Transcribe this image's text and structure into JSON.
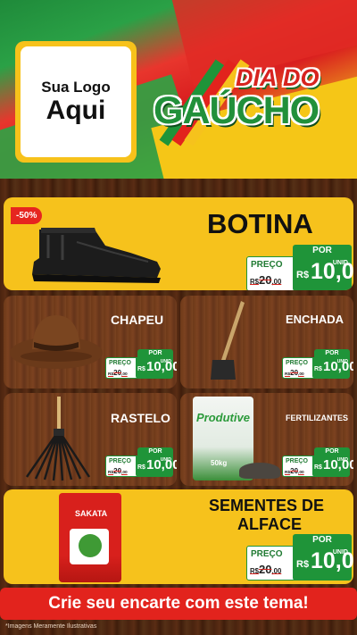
{
  "header": {
    "logo_line1": "Sua Logo",
    "logo_line2": "Aqui",
    "title_top": "DIA DO",
    "title_bottom": "GAÚCHO"
  },
  "colors": {
    "green": "#1f9439",
    "red": "#e2231d",
    "yellow": "#f6c21c",
    "wood": "#4a230f"
  },
  "products": {
    "botina": {
      "name": "BOTINA",
      "discount": "-50%",
      "por": "POR",
      "preco": "PREÇO",
      "old_int": "20",
      "old_dec": ",00",
      "currency": "R$",
      "value": "10,00",
      "unit": "UNID"
    },
    "chapeu": {
      "name": "CHAPEU",
      "por": "POR",
      "preco": "PREÇO",
      "old_int": "20",
      "old_dec": ",00",
      "currency": "R$",
      "value": "10,00",
      "unit": "UNID"
    },
    "enchada": {
      "name": "ENCHADA",
      "por": "POR",
      "preco": "PREÇO",
      "old_int": "20",
      "old_dec": ",00",
      "currency": "R$",
      "value": "10,00",
      "unit": "UNID"
    },
    "rastelo": {
      "name": "RASTELO",
      "por": "POR",
      "preco": "PREÇO",
      "old_int": "20",
      "old_dec": ",00",
      "currency": "R$",
      "value": "10,00",
      "unit": "UNID"
    },
    "fertilizantes": {
      "name": "FERTILIZANTES",
      "por": "POR",
      "preco": "PREÇO",
      "old_int": "20",
      "old_dec": ",00",
      "currency": "R$",
      "value": "10,00",
      "unit": "UNID",
      "bag_brand": "Produtive",
      "bag_weight": "50kg"
    },
    "sementes": {
      "name_line1": "SEMENTES DE",
      "name_line2": "ALFACE",
      "por": "POR",
      "preco": "PREÇO",
      "old_int": "20",
      "old_dec": ",00",
      "currency": "R$",
      "value": "10,00",
      "unit": "UNID",
      "pack_brand": "SAKATA"
    }
  },
  "cta": "Crie seu encarte com este tema!",
  "footnote": "*Imagens Meramente Ilustrativas"
}
